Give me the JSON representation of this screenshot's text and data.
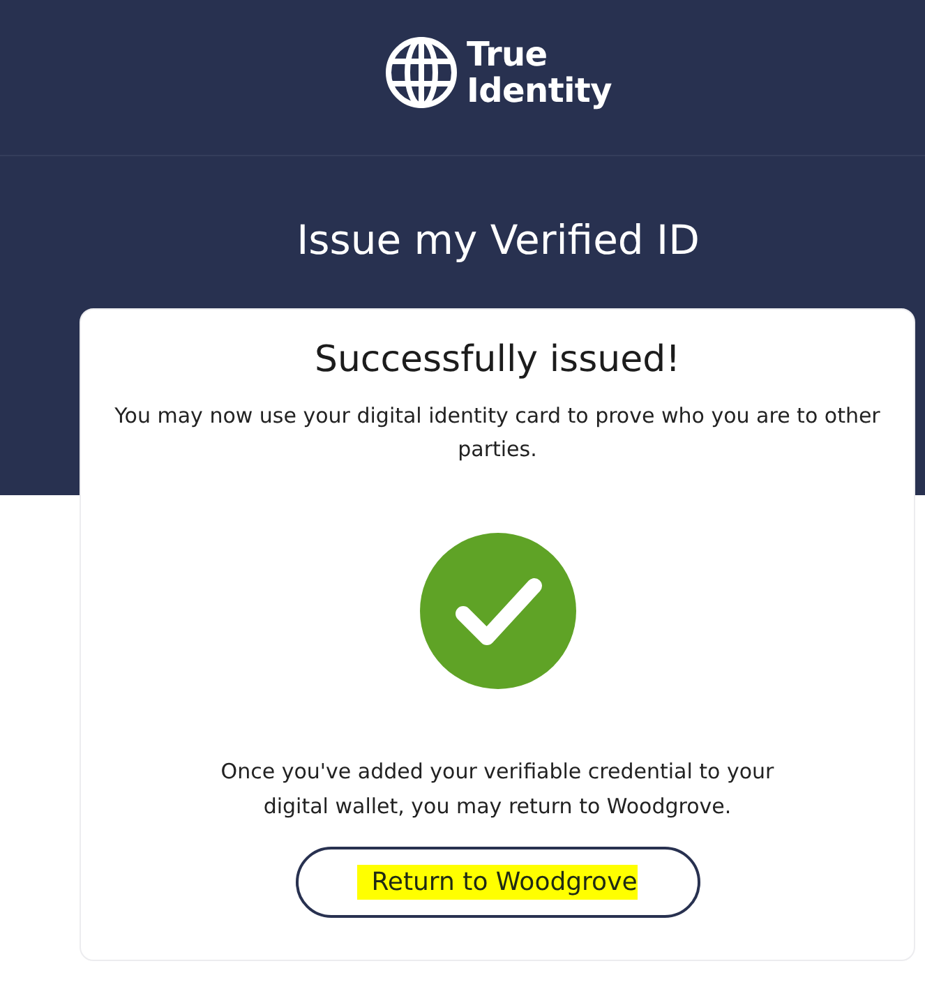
{
  "header": {
    "brand": "True Identity"
  },
  "page_title": "Issue my Verified ID",
  "card": {
    "title": "Successfully issued!",
    "message": "You may now use your digital identity card to prove who you are to other parties.",
    "issued": true,
    "note": "Once you've added your verifiable credential to your digital wallet, you may return to Woodgrove.",
    "button": {
      "label": "Return to Woodgrove",
      "highlighted": true
    }
  }
}
